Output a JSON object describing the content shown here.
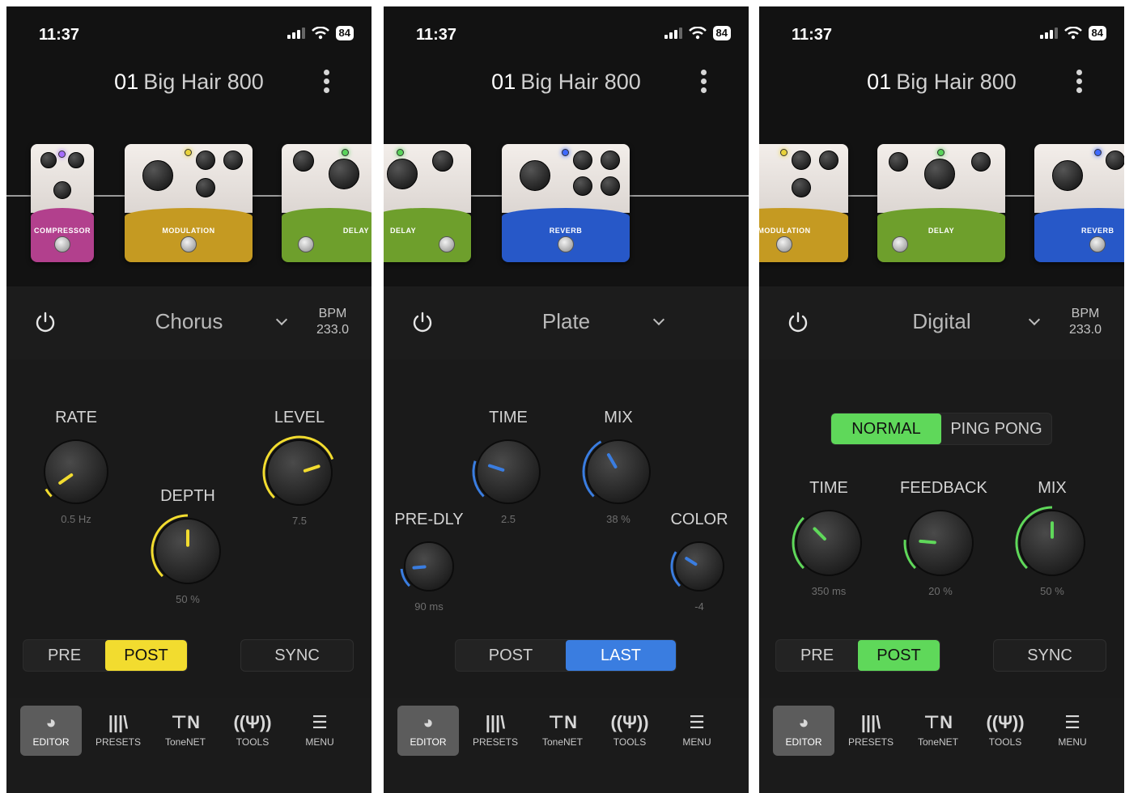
{
  "screens": [
    {
      "status": {
        "time": "11:37",
        "battery": "84"
      },
      "header": {
        "preset_number": "01",
        "preset_name": "Big Hair 800"
      },
      "pedals": [
        {
          "name": "COMPRESSOR",
          "color": "#b2408d",
          "led": "#a66cff"
        },
        {
          "name": "MODULATION",
          "color": "#c59a22",
          "led": "#e8d23a"
        },
        {
          "name": "DELAY",
          "color": "#6e9f2c",
          "led": "#59d35a"
        }
      ],
      "effect": {
        "type": "Chorus",
        "bpm_label": "BPM",
        "bpm_value": "233.0"
      },
      "accent": "#f2dc2f",
      "knobs": [
        {
          "label": "RATE",
          "value": "0.5 Hz"
        },
        {
          "label": "DEPTH",
          "value": "50 %"
        },
        {
          "label": "LEVEL",
          "value": "7.5"
        }
      ],
      "order": {
        "options": [
          "PRE",
          "POST"
        ],
        "selected": "POST"
      },
      "sync_label": "SYNC"
    },
    {
      "status": {
        "time": "11:37",
        "battery": "84"
      },
      "header": {
        "preset_number": "01",
        "preset_name": "Big Hair 800"
      },
      "pedals": [
        {
          "name": "DELAY",
          "color": "#6e9f2c",
          "led": "#59d35a"
        },
        {
          "name": "REVERB",
          "color": "#2758c8",
          "led": "#3f69ff"
        }
      ],
      "effect": {
        "type": "Plate"
      },
      "accent": "#3a7de0",
      "knobs": [
        {
          "label": "TIME",
          "value": "2.5"
        },
        {
          "label": "MIX",
          "value": "38 %"
        },
        {
          "label": "PRE-DLY",
          "value": "90 ms"
        },
        {
          "label": "COLOR",
          "value": "-4"
        }
      ],
      "order": {
        "options": [
          "POST",
          "LAST"
        ],
        "selected": "LAST"
      }
    },
    {
      "status": {
        "time": "11:37",
        "battery": "84"
      },
      "header": {
        "preset_number": "01",
        "preset_name": "Big Hair 800"
      },
      "pedals": [
        {
          "name": "MODULATION",
          "color": "#c59a22",
          "led": "#e8d23a"
        },
        {
          "name": "DELAY",
          "color": "#6e9f2c",
          "led": "#59d35a"
        },
        {
          "name": "REVERB",
          "color": "#2758c8",
          "led": "#3f69ff"
        }
      ],
      "effect": {
        "type": "Digital",
        "bpm_label": "BPM",
        "bpm_value": "233.0"
      },
      "accent": "#5fd85a",
      "mode": {
        "options": [
          "NORMAL",
          "PING PONG"
        ],
        "selected": "NORMAL"
      },
      "knobs": [
        {
          "label": "TIME",
          "value": "350 ms"
        },
        {
          "label": "FEEDBACK",
          "value": "20 %"
        },
        {
          "label": "MIX",
          "value": "50 %"
        }
      ],
      "order": {
        "options": [
          "PRE",
          "POST"
        ],
        "selected": "POST"
      },
      "sync_label": "SYNC"
    }
  ],
  "nav": [
    {
      "label": "EDITOR",
      "icon": "editor-icon",
      "glyph": "◕"
    },
    {
      "label": "PRESETS",
      "icon": "presets-icon",
      "glyph": "|||\\"
    },
    {
      "label": "ToneNET",
      "icon": "tonenet-icon",
      "glyph": "⊤N"
    },
    {
      "label": "TOOLS",
      "icon": "tuning-fork-icon",
      "glyph": "((Ψ))"
    },
    {
      "label": "MENU",
      "icon": "hamburger-menu-icon",
      "glyph": "☰"
    }
  ],
  "nav_active": "EDITOR"
}
